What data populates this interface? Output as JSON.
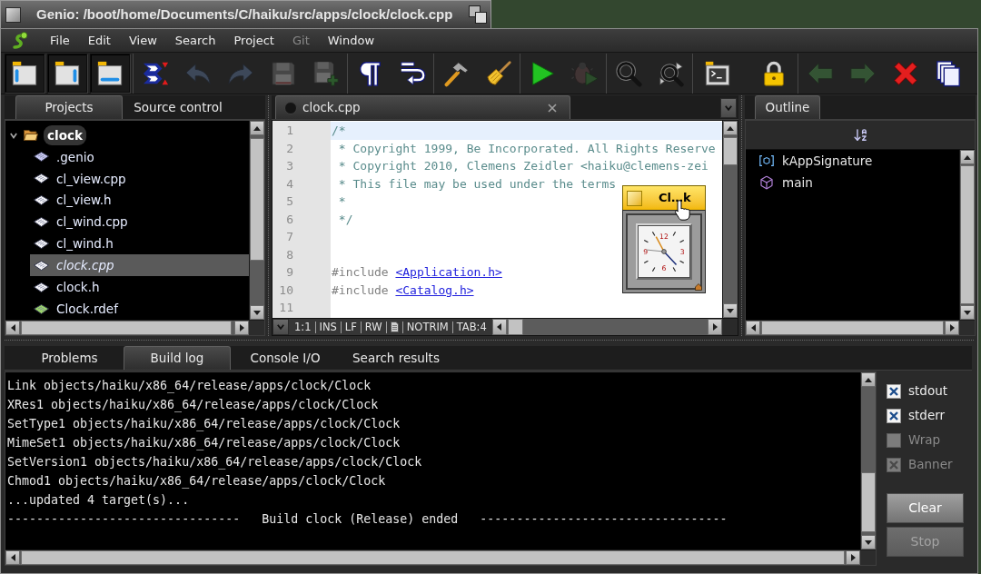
{
  "window": {
    "title": "Genio: /boot/home/Documents/C/haiku/src/apps/clock/clock.cpp"
  },
  "menu": [
    {
      "label": "File",
      "disabled": false
    },
    {
      "label": "Edit",
      "disabled": false
    },
    {
      "label": "View",
      "disabled": false
    },
    {
      "label": "Search",
      "disabled": false
    },
    {
      "label": "Project",
      "disabled": false
    },
    {
      "label": "Git",
      "disabled": true
    },
    {
      "label": "Window",
      "disabled": false
    }
  ],
  "toolbar": [
    [
      {
        "pressed": true,
        "disabled": false
      },
      {
        "pressed": true,
        "disabled": false
      },
      {
        "pressed": true,
        "disabled": false
      }
    ],
    [
      {
        "pressed": false,
        "disabled": false
      },
      {
        "pressed": false,
        "disabled": true
      },
      {
        "pressed": false,
        "disabled": true
      },
      {
        "pressed": false,
        "disabled": true
      },
      {
        "pressed": false,
        "disabled": true
      }
    ],
    [
      {
        "pressed": false,
        "disabled": false
      },
      {
        "pressed": false,
        "disabled": false
      }
    ],
    [
      {
        "pressed": false,
        "disabled": false
      },
      {
        "pressed": false,
        "disabled": false
      }
    ],
    [
      {
        "pressed": false,
        "disabled": false
      },
      {
        "pressed": false,
        "disabled": true
      }
    ],
    [
      {
        "pressed": false,
        "disabled": false
      },
      {
        "pressed": false,
        "disabled": false
      }
    ],
    [
      {
        "pressed": false,
        "disabled": false
      },
      {
        "pressed": false,
        "disabled": false
      }
    ],
    [
      {
        "pressed": false,
        "disabled": true
      },
      {
        "pressed": false,
        "disabled": true
      },
      {
        "pressed": false,
        "disabled": false
      },
      {
        "pressed": false,
        "disabled": false
      }
    ]
  ],
  "projects": {
    "tabs": [
      {
        "label": "Projects",
        "selected": true
      },
      {
        "label": "Source control",
        "selected": false
      }
    ],
    "tree": [
      {
        "name": "clock",
        "expanded": true,
        "active": true,
        "children": [
          {
            "name": ".genio",
            "kind": "config",
            "selected": false,
            "open": false
          },
          {
            "name": "cl_view.cpp",
            "kind": "source",
            "selected": false,
            "open": false
          },
          {
            "name": "cl_view.h",
            "kind": "source",
            "selected": false,
            "open": false
          },
          {
            "name": "cl_wind.cpp",
            "kind": "source",
            "selected": false,
            "open": false
          },
          {
            "name": "cl_wind.h",
            "kind": "source",
            "selected": false,
            "open": false
          },
          {
            "name": "clock.cpp",
            "kind": "source",
            "selected": true,
            "open": true
          },
          {
            "name": "clock.h",
            "kind": "source",
            "selected": false,
            "open": false
          },
          {
            "name": "Clock.rdef",
            "kind": "resource",
            "selected": false,
            "open": false
          }
        ]
      }
    ]
  },
  "editor": {
    "tabs": [
      {
        "label": "clock.cpp",
        "selected": true
      }
    ],
    "lines": [
      {
        "number": "1",
        "current": true,
        "parts": [
          {
            "kind": "comment",
            "text": "/*"
          }
        ]
      },
      {
        "number": "2",
        "current": false,
        "parts": [
          {
            "kind": "comment",
            "text": " * Copyright 1999, Be Incorporated. All Rights Reserve"
          }
        ]
      },
      {
        "number": "3",
        "current": false,
        "parts": [
          {
            "kind": "comment",
            "text": " * Copyright 2010, Clemens Zeidler <haiku@clemens-zei"
          }
        ]
      },
      {
        "number": "4",
        "current": false,
        "parts": [
          {
            "kind": "comment",
            "text": " * This file may be used under the terms"
          }
        ]
      },
      {
        "number": "5",
        "current": false,
        "parts": [
          {
            "kind": "comment",
            "text": " *"
          }
        ]
      },
      {
        "number": "6",
        "current": false,
        "parts": [
          {
            "kind": "comment",
            "text": " */"
          }
        ]
      },
      {
        "number": "7",
        "current": false
      },
      {
        "number": "8",
        "current": false
      },
      {
        "number": "9",
        "current": false,
        "parts": [
          {
            "kind": "directive",
            "text": "#include"
          },
          {
            "kind": "header",
            "text": "<Application.h>"
          }
        ]
      },
      {
        "number": "10",
        "current": false,
        "parts": [
          {
            "kind": "directive",
            "text": "#include"
          },
          {
            "kind": "header",
            "text": "<Catalog.h>"
          }
        ]
      },
      {
        "number": "11",
        "current": false
      }
    ],
    "status": [
      {
        "kind": "text",
        "text": "1:1"
      },
      {
        "kind": "text",
        "text": "INS"
      },
      {
        "kind": "text",
        "text": "LF"
      },
      {
        "kind": "text",
        "text": "RW"
      },
      {
        "kind": "icon"
      },
      {
        "kind": "text",
        "text": "NOTRIM"
      },
      {
        "kind": "text",
        "text": "TAB:4"
      }
    ]
  },
  "clock_window": {
    "title": "Cl…k",
    "numerals": [
      "12",
      "3",
      "6",
      "9"
    ]
  },
  "outline": {
    "tabs": [
      {
        "label": "Outline",
        "selected": true
      }
    ],
    "items": [
      {
        "name": "kAppSignature",
        "kind": "variable"
      },
      {
        "name": "main",
        "kind": "function"
      }
    ]
  },
  "bottom": {
    "tabs": [
      {
        "label": "Problems",
        "selected": false
      },
      {
        "label": "Build log",
        "selected": true
      },
      {
        "label": "Console I/O",
        "selected": false
      },
      {
        "label": "Search results",
        "selected": false
      }
    ],
    "log": [
      "Link objects/haiku/x86_64/release/apps/clock/Clock",
      "XRes1 objects/haiku/x86_64/release/apps/clock/Clock",
      "SetType1 objects/haiku/x86_64/release/apps/clock/Clock",
      "MimeSet1 objects/haiku/x86_64/release/apps/clock/Clock",
      "SetVersion1 objects/haiku/x86_64/release/apps/clock/Clock",
      "Chmod1 objects/haiku/x86_64/release/apps/clock/Clock",
      "...updated 4 target(s)...",
      "--------------------------------   Build clock (Release) ended   ----------------------------------"
    ],
    "options": [
      {
        "label": "stdout",
        "checked": true,
        "disabled": false
      },
      {
        "label": "stderr",
        "checked": true,
        "disabled": false
      },
      {
        "label": "Wrap",
        "checked": false,
        "disabled": true
      },
      {
        "label": "Banner",
        "checked": true,
        "disabled": true
      }
    ],
    "buttons": [
      {
        "label": "Clear",
        "disabled": false
      },
      {
        "label": "Stop",
        "disabled": true
      }
    ]
  }
}
